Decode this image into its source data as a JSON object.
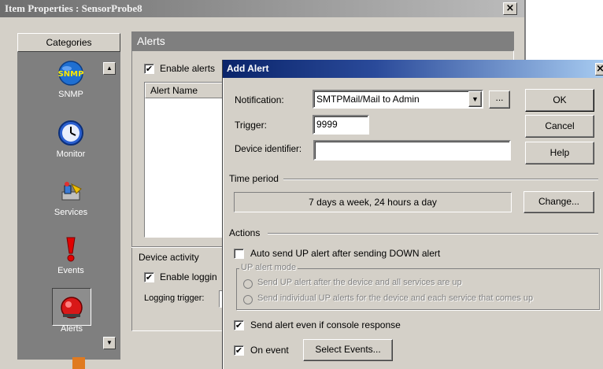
{
  "parent_window": {
    "title": "Item Properties : SensorProbe8",
    "close_glyph": "×",
    "categories_header": "Categories",
    "categories": [
      {
        "label": "SNMP",
        "icon": "snmp-icon"
      },
      {
        "label": "Monitor",
        "icon": "clock-icon"
      },
      {
        "label": "Services",
        "icon": "services-icon"
      },
      {
        "label": "Events",
        "icon": "exclamation-icon"
      },
      {
        "label": "Alerts",
        "icon": "alarm-bell-icon"
      }
    ],
    "alerts_header": "Alerts",
    "enable_alerts_label": "Enable alerts",
    "enable_alerts_checked": true,
    "alert_name_column": "Alert Name",
    "device_activity_label": "Device activity",
    "enable_logging_label": "Enable loggin",
    "enable_logging_checked": true,
    "logging_trigger_label": "Logging trigger:"
  },
  "dialog": {
    "title": "Add Alert",
    "close_glyph": "×",
    "notification_label": "Notification:",
    "notification_value": "SMTPMail/Mail to Admin",
    "browse_label": "...",
    "trigger_label": "Trigger:",
    "trigger_value": "9999",
    "device_identifier_label": "Device identifier:",
    "device_identifier_value": "",
    "ok_label": "OK",
    "cancel_label": "Cancel",
    "help_label": "Help",
    "time_period_label": "Time period",
    "time_period_value": "7 days a week, 24 hours a day",
    "change_label": "Change...",
    "actions_label": "Actions",
    "auto_send_up_label": "Auto send UP alert after sending DOWN alert",
    "auto_send_up_checked": false,
    "up_alert_mode_label": "UP alert mode",
    "up_mode_option1": "Send UP alert after the device and all services are up",
    "up_mode_option2": "Send individual UP alerts for the device and each service that comes up",
    "send_even_if_console_label": "Send alert even if console response",
    "send_even_if_console_checked": true,
    "on_event_label": "On event",
    "on_event_checked": true,
    "select_events_label": "Select Events..."
  },
  "colors": {
    "dialog_title_start": "#0a246a",
    "dialog_title_end": "#a6caf0",
    "window_face": "#d4d0c8",
    "category_panel": "#7f7f7f"
  }
}
